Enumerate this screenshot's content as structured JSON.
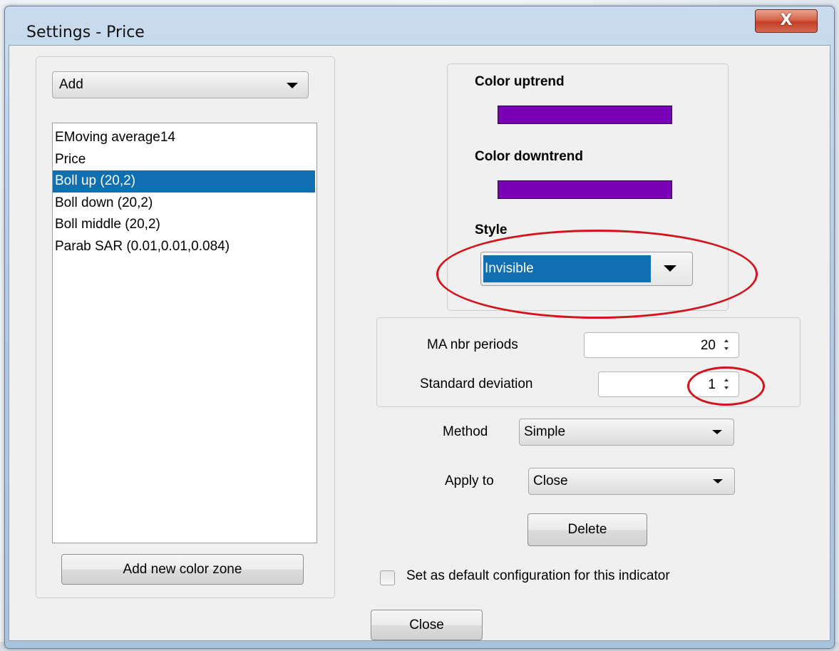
{
  "window": {
    "title": "Settings - Price",
    "close_glyph": "X"
  },
  "left": {
    "add_combo_value": "Add",
    "indicators": [
      {
        "label": "EMoving average14",
        "selected": false
      },
      {
        "label": "Price",
        "selected": false
      },
      {
        "label": "Boll up (20,2)",
        "selected": true
      },
      {
        "label": "Boll down (20,2)",
        "selected": false
      },
      {
        "label": "Boll middle (20,2)",
        "selected": false
      },
      {
        "label": "Parab SAR (0.01,0.01,0.084)",
        "selected": false
      }
    ],
    "add_zone_button": "Add new color zone"
  },
  "colors": {
    "uptrend_label": "Color uptrend",
    "uptrend_color": "#7a00b5",
    "downtrend_label": "Color downtrend",
    "downtrend_color": "#7a00b5",
    "style_label": "Style",
    "style_value": "Invisible"
  },
  "params": {
    "ma_periods_label": "MA nbr periods",
    "ma_periods_value": "20",
    "std_dev_label": "Standard deviation",
    "std_dev_value": "1"
  },
  "method": {
    "label": "Method",
    "value": "Simple"
  },
  "apply_to": {
    "label": "Apply to",
    "value": "Close"
  },
  "delete_button": "Delete",
  "default_config": {
    "label": "Set as default configuration for this indicator",
    "checked": false
  },
  "close_button": "Close",
  "annotation_color": "#d4131b"
}
